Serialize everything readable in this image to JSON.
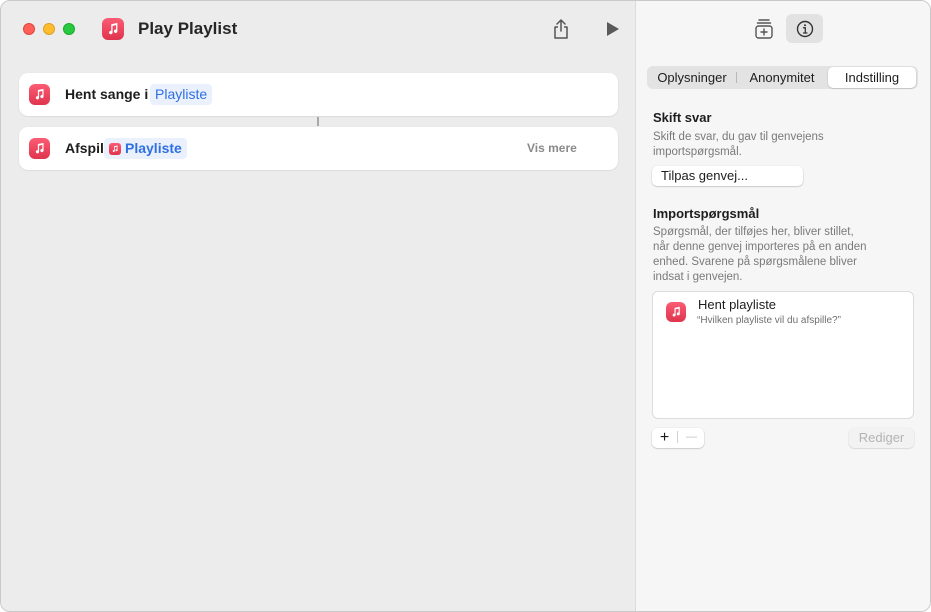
{
  "window": {
    "title": "Play Playlist"
  },
  "actions": [
    {
      "label": "Hent sange i",
      "token": "Playliste"
    },
    {
      "label": "Afspil",
      "token": "Playliste",
      "more": "Vis mere"
    }
  ],
  "inspector": {
    "tabs": [
      "Oplysninger",
      "Anonymitet",
      "Indstilling"
    ],
    "selected_tab": "Indstilling",
    "skift_svar": {
      "heading": "Skift svar",
      "desc_line1": "Skift de svar, du gav til genvejens",
      "desc_line2": "importspørgsmål.",
      "button": "Tilpas genvej..."
    },
    "import": {
      "heading": "Importspørgsmål",
      "desc_lines": [
        "Spørgsmål, der tilføjes her, bliver stillet,",
        "når denne genvej importeres på en anden",
        "enhed. Svarene på spørgsmålene bliver",
        "indsat i genvejen."
      ],
      "question_title": "Hent playliste",
      "question_sub": "“Hvilken playliste vil du afspille?”",
      "add": "+",
      "remove": "—",
      "edit": "Rediger"
    }
  },
  "icons": {
    "app": "music-note-icon",
    "share": "share-icon",
    "run": "play-icon",
    "library": "add-to-library-icon",
    "info": "info-icon"
  },
  "colors": {
    "music_red": "#f2455f",
    "token_blue": "#2f6fe4"
  }
}
